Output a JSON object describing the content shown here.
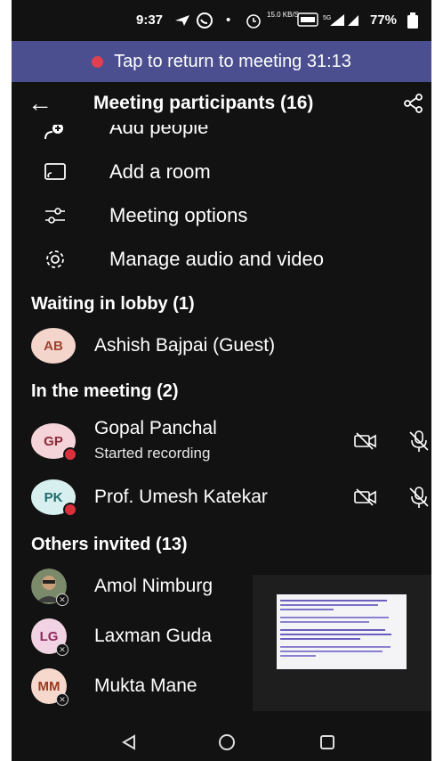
{
  "status_bar": {
    "time": "9:37",
    "net_speed": "15.0 KB/S",
    "battery": "77%"
  },
  "banner": {
    "text": "Tap to return to meeting 31:13",
    "color": "#4b4f8f"
  },
  "header": {
    "title": "Meeting participants (16)"
  },
  "menu": {
    "add_people": "Add people",
    "add_room": "Add a room",
    "meeting_options": "Meeting options",
    "manage_av": "Manage audio and video"
  },
  "lobby": {
    "heading": "Waiting in lobby (1)",
    "people": [
      {
        "initials": "AB",
        "name": "Ashish Bajpai (Guest)"
      }
    ]
  },
  "in_meeting": {
    "heading": "In the meeting (2)",
    "people": [
      {
        "initials": "GP",
        "name": "Gopal Panchal",
        "status": "Started recording"
      },
      {
        "initials": "PK",
        "name": "Prof. Umesh Katekar"
      }
    ]
  },
  "invited": {
    "heading": "Others invited (13)",
    "people": [
      {
        "initials": "",
        "name": "Amol Nimburg"
      },
      {
        "initials": "LG",
        "name": "Laxman Guda"
      },
      {
        "initials": "MM",
        "name": "Mukta Mane"
      }
    ]
  }
}
